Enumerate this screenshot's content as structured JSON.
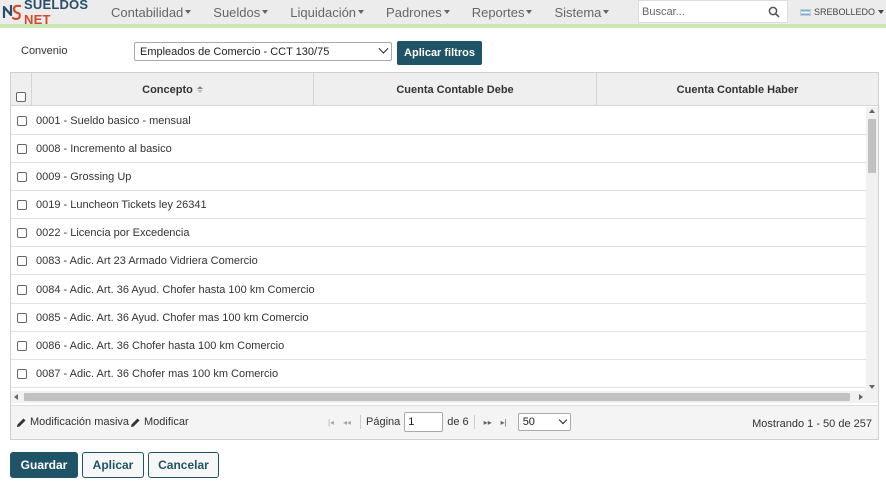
{
  "brand": {
    "name_main": "SUELDOS",
    "name_accent": "NET"
  },
  "nav": {
    "items": [
      {
        "label": "Contabilidad"
      },
      {
        "label": "Sueldos"
      },
      {
        "label": "Liquidación"
      },
      {
        "label": "Padrones"
      },
      {
        "label": "Reportes"
      },
      {
        "label": "Sistema"
      }
    ],
    "search_placeholder": "Buscar...",
    "user": "SREBOLLEDO"
  },
  "filters": {
    "convenio_label": "Convenio",
    "convenio_value": "Empleados de Comercio - CCT 130/75",
    "apply_label": "Aplicar filtros"
  },
  "grid": {
    "columns": [
      {
        "label": "Concepto"
      },
      {
        "label": "Cuenta Contable Debe"
      },
      {
        "label": "Cuenta Contable Haber"
      }
    ],
    "rows": [
      {
        "concepto": "0001 - Sueldo basico - mensual"
      },
      {
        "concepto": "0008 - Incremento al basico"
      },
      {
        "concepto": "0009 - Grossing Up"
      },
      {
        "concepto": "0019 - Luncheon Tickets ley 26341"
      },
      {
        "concepto": "0022 - Licencia por Excedencia"
      },
      {
        "concepto": "0083 - Adic. Art 23 Armado Vidriera Comercio"
      },
      {
        "concepto": "0084 - Adic. Art. 36 Ayud. Chofer hasta 100 km Comercio"
      },
      {
        "concepto": "0085 - Adic. Art. 36 Ayud. Chofer mas 100 km Comercio"
      },
      {
        "concepto": "0086 - Adic. Art. 36 Chofer hasta 100 km Comercio"
      },
      {
        "concepto": "0087 - Adic. Art. 36 Chofer mas 100 km Comercio"
      }
    ],
    "footer": {
      "bulk_edit_label": "Modificación masiva",
      "edit_label": "Modificar",
      "page_label": "Página",
      "page_value": "1",
      "of_pages": "de 6",
      "per_page": "50",
      "record_count": "Mostrando 1 - 50 de 257"
    }
  },
  "actions": {
    "save_label": "Guardar",
    "apply_label": "Aplicar",
    "cancel_label": "Cancelar"
  },
  "colors": {
    "primary": "#1f5466",
    "brand_blue": "#2a4d6b",
    "brand_red": "#d04a2b",
    "accent_line": "#c9e8b4",
    "navbar_bg": "#ececec"
  }
}
